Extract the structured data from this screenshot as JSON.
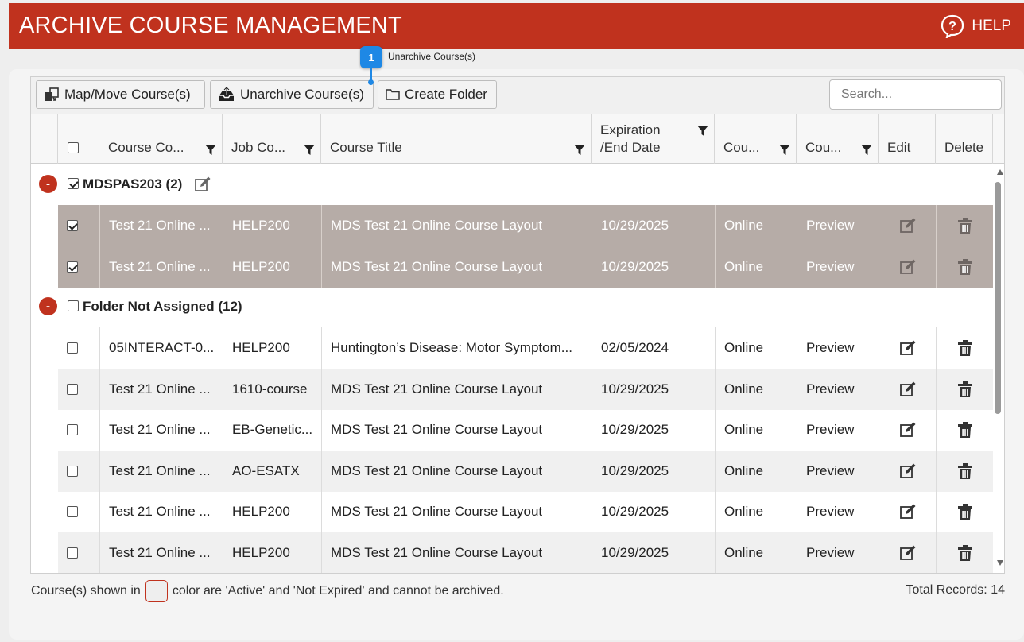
{
  "header": {
    "title": "ARCHIVE COURSE MANAGEMENT",
    "help_label": "HELP"
  },
  "annotation": {
    "number": "1",
    "label": "Unarchive Course(s)"
  },
  "toolbar": {
    "map_move_label": "Map/Move Course(s)",
    "unarchive_label": "Unarchive Course(s)",
    "create_folder_label": "Create Folder",
    "search_placeholder": "Search..."
  },
  "columns": {
    "course_code": "Course Co...",
    "job_code": "Job Co...",
    "course_title": "Course Title",
    "expiration_line1": "Expiration",
    "expiration_line2": "/End Date",
    "col6": "Cou...",
    "col7": "Cou...",
    "edit": "Edit",
    "delete": "Delete"
  },
  "groups": [
    {
      "name": "MDSPAS203 (2)",
      "checked": true,
      "rows": [
        {
          "code": "Test 21 Online ...",
          "job": "HELP200",
          "title": "MDS Test 21 Online Course Layout",
          "date": "10/29/2025",
          "type": "Online",
          "mode": "Preview",
          "checked": true
        },
        {
          "code": "Test 21 Online ...",
          "job": "HELP200",
          "title": "MDS Test 21 Online Course Layout",
          "date": "10/29/2025",
          "type": "Online",
          "mode": "Preview",
          "checked": true
        }
      ]
    },
    {
      "name": "Folder Not Assigned (12)",
      "checked": false,
      "rows": [
        {
          "code": "05INTERACT-0...",
          "job": "HELP200",
          "title": "Huntington’s Disease: Motor Symptom...",
          "date": "02/05/2024",
          "type": "Online",
          "mode": "Preview",
          "checked": false
        },
        {
          "code": "Test 21 Online ...",
          "job": "1610-course",
          "title": "MDS Test 21 Online Course Layout",
          "date": "10/29/2025",
          "type": "Online",
          "mode": "Preview",
          "checked": false
        },
        {
          "code": "Test 21 Online ...",
          "job": "EB-Genetic...",
          "title": "MDS Test 21 Online Course Layout",
          "date": "10/29/2025",
          "type": "Online",
          "mode": "Preview",
          "checked": false
        },
        {
          "code": "Test 21 Online ...",
          "job": "AO-ESATX",
          "title": "MDS Test 21 Online Course Layout",
          "date": "10/29/2025",
          "type": "Online",
          "mode": "Preview",
          "checked": false
        },
        {
          "code": "Test 21 Online ...",
          "job": "HELP200",
          "title": "MDS Test 21 Online Course Layout",
          "date": "10/29/2025",
          "type": "Online",
          "mode": "Preview",
          "checked": false
        },
        {
          "code": "Test 21 Online ...",
          "job": "HELP200",
          "title": "MDS Test 21 Online Course Layout",
          "date": "10/29/2025",
          "type": "Online",
          "mode": "Preview",
          "checked": false
        }
      ]
    }
  ],
  "footer": {
    "note_before": "Course(s) shown in",
    "note_after": "color are 'Active' and 'Not Expired' and cannot be archived.",
    "total_records": "Total Records: 14"
  },
  "colors": {
    "brand": "#c0321e",
    "selected_row": "#b6aca7",
    "annotation": "#1e88e5"
  },
  "icons": {
    "help": "question-circle-icon",
    "map_move": "map-move-icon",
    "unarchive": "unarchive-icon",
    "folder": "folder-icon",
    "filter": "filter-icon",
    "edit": "edit-icon",
    "delete": "trash-icon"
  }
}
